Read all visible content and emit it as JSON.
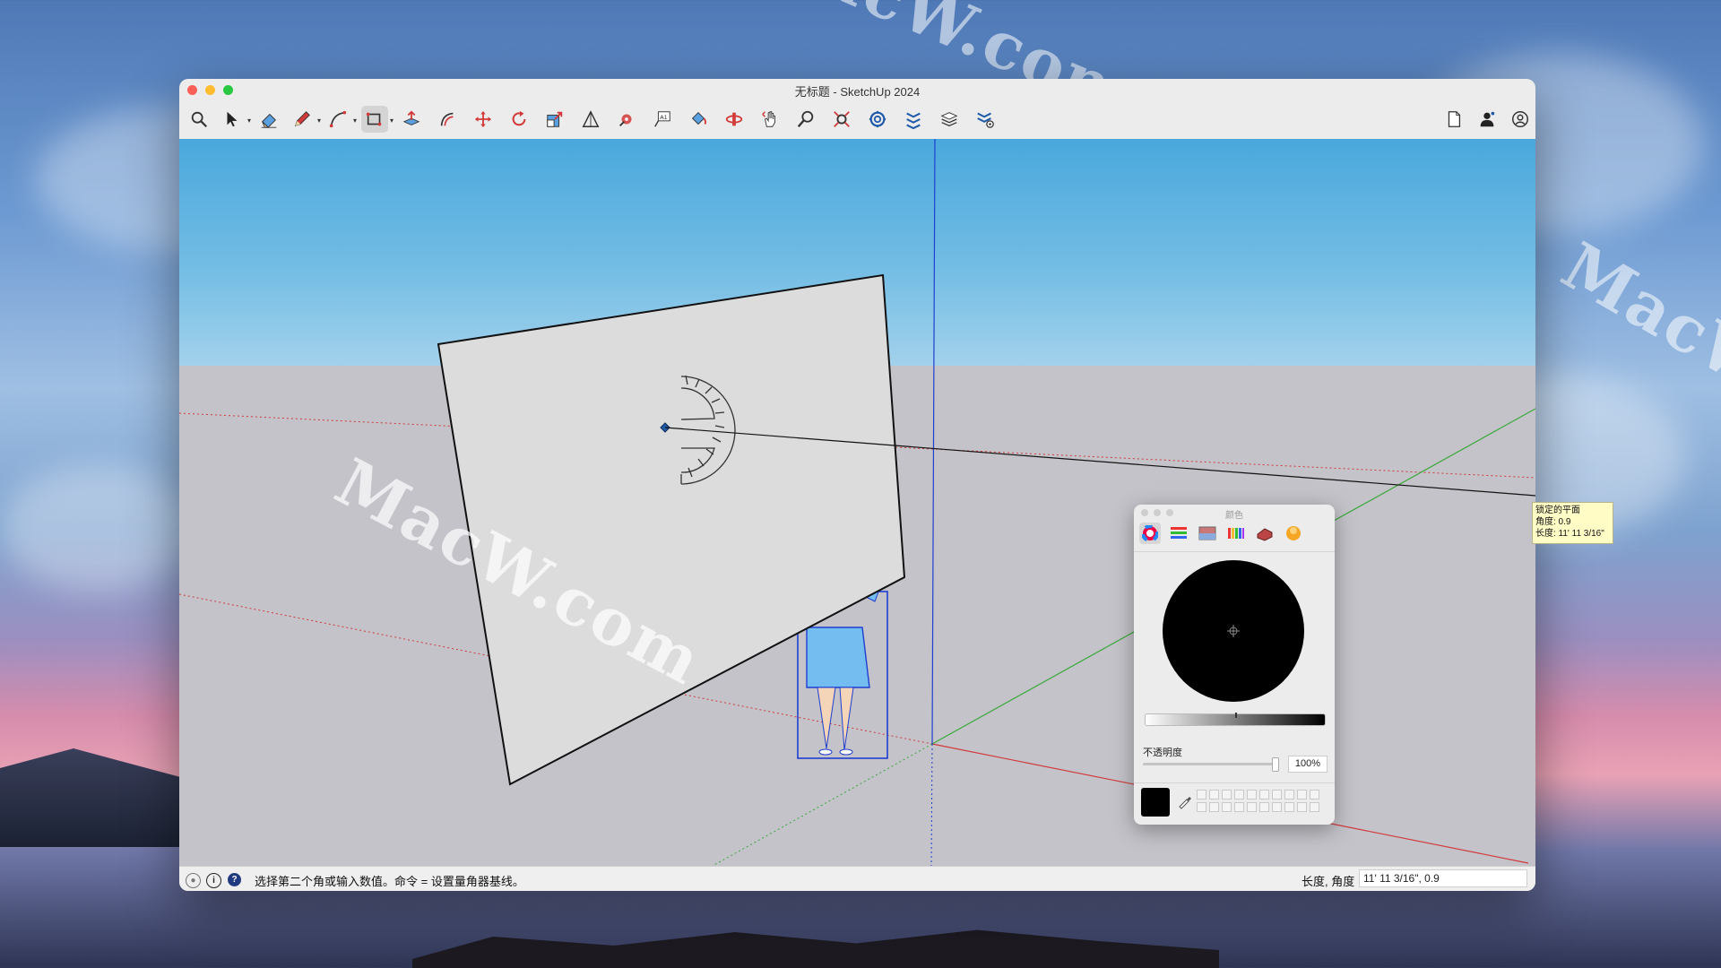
{
  "watermark": {
    "text": "MacW.com"
  },
  "window": {
    "title": "无标题 - SketchUp 2024"
  },
  "toolbar": {
    "left_tools": [
      {
        "name": "search-tool-icon"
      },
      {
        "name": "select-tool-icon"
      },
      {
        "name": "eraser-tool-icon"
      },
      {
        "name": "pencil-line-tool-icon"
      },
      {
        "name": "arc-tool-icon"
      },
      {
        "name": "rectangle-tool-icon"
      },
      {
        "name": "push-pull-tool-icon"
      },
      {
        "name": "follow-me-tool-icon"
      },
      {
        "name": "move-tool-icon"
      },
      {
        "name": "rotate-tool-icon"
      },
      {
        "name": "scale-tool-icon"
      },
      {
        "name": "tape-measure-tool-icon"
      },
      {
        "name": "protractor-tool-icon"
      },
      {
        "name": "text-tool-icon"
      },
      {
        "name": "paint-bucket-tool-icon"
      },
      {
        "name": "orbit-tool-icon"
      },
      {
        "name": "pan-tool-icon"
      },
      {
        "name": "zoom-tool-icon"
      },
      {
        "name": "zoom-extents-tool-icon"
      },
      {
        "name": "3d-warehouse-tool-icon"
      },
      {
        "name": "extension-warehouse-tool-icon"
      },
      {
        "name": "layers-tool-icon"
      },
      {
        "name": "extension-manager-tool-icon"
      }
    ],
    "right_tools": [
      {
        "name": "new-document-icon"
      },
      {
        "name": "user-account-icon"
      },
      {
        "name": "profile-icon"
      }
    ]
  },
  "tooltip": {
    "line1": "锁定的平面",
    "line2": "角度: 0.9",
    "line3": "长度: 11' 11 3/16\""
  },
  "colors_panel": {
    "title": "颜色",
    "opacity_label": "不透明度",
    "opacity_value": "100%",
    "opacity_level": 1.0,
    "selected_color": "#000000"
  },
  "statusbar": {
    "hint": "选择第二个角或输入数值。命令 = 设置量角器基线。",
    "measure_label": "长度, 角度",
    "measure_value": "11' 11 3/16\", 0.9"
  }
}
